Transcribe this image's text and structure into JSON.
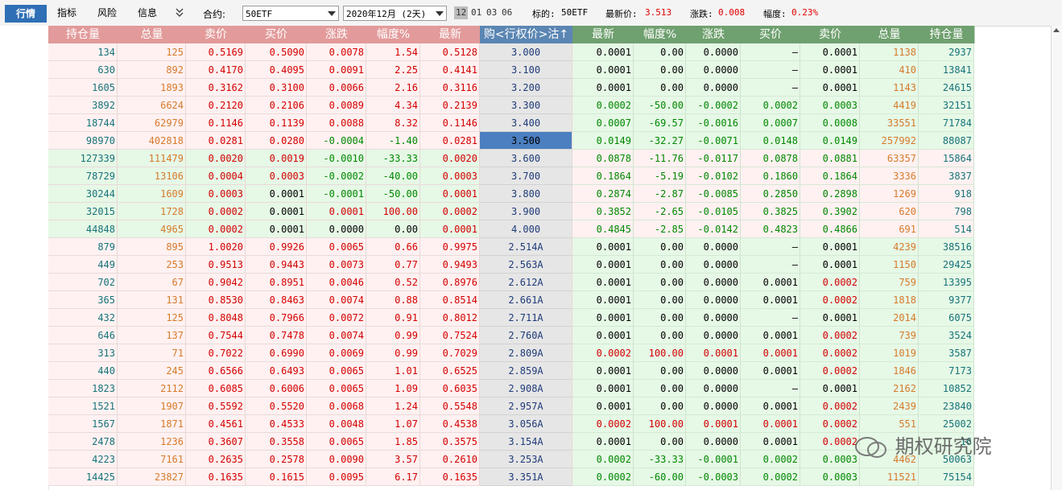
{
  "tabs": [
    {
      "label": "行情"
    },
    {
      "label": "指标"
    },
    {
      "label": "风险"
    },
    {
      "label": "信息"
    }
  ],
  "contract_label": "合约:",
  "contract_value": "50ETF",
  "month_value": "2020年12月 (2天)",
  "months": [
    "12",
    "01",
    "03",
    "06"
  ],
  "underlying_label": "标的:",
  "underlying_value": "50ETF",
  "last_label": "最新价:",
  "last_value": "3.513",
  "change_label": "涨跌:",
  "change_value": "0.008",
  "pct_label": "幅度:",
  "pct_value": "0.23%",
  "headers_left": [
    "持仓量",
    "总量",
    "卖价",
    "买价",
    "涨跌",
    "幅度%",
    "最新"
  ],
  "header_center": "购<行权价>沽↑",
  "headers_right": [
    "最新",
    "幅度%",
    "涨跌",
    "买价",
    "卖价",
    "总量",
    "持仓量"
  ],
  "rows": [
    [
      "134",
      "125",
      "0.5169",
      "0.5090",
      "0.0078",
      "1.54",
      "0.5128",
      "3.000",
      "0.0001",
      "0.00",
      "0.0000",
      "–",
      "0.0001",
      "1138",
      "2937"
    ],
    [
      "630",
      "892",
      "0.4170",
      "0.4095",
      "0.0091",
      "2.25",
      "0.4141",
      "3.100",
      "0.0001",
      "0.00",
      "0.0000",
      "–",
      "0.0001",
      "410",
      "13841"
    ],
    [
      "1605",
      "1893",
      "0.3162",
      "0.3100",
      "0.0066",
      "2.16",
      "0.3116",
      "3.200",
      "0.0001",
      "0.00",
      "0.0000",
      "–",
      "0.0001",
      "1143",
      "24615"
    ],
    [
      "3892",
      "6624",
      "0.2120",
      "0.2106",
      "0.0089",
      "4.34",
      "0.2139",
      "3.300",
      "0.0002",
      "-50.00",
      "-0.0002",
      "0.0002",
      "0.0003",
      "4419",
      "32151"
    ],
    [
      "18744",
      "62979",
      "0.1146",
      "0.1139",
      "0.0088",
      "8.32",
      "0.1146",
      "3.400",
      "0.0007",
      "-69.57",
      "-0.0016",
      "0.0007",
      "0.0008",
      "33551",
      "71784"
    ],
    [
      "98970",
      "402818",
      "0.0281",
      "0.0280",
      "-0.0004",
      "-1.40",
      "0.0281",
      "3.500",
      "0.0149",
      "-32.27",
      "-0.0071",
      "0.0148",
      "0.0149",
      "257992",
      "88087"
    ],
    [
      "127339",
      "111479",
      "0.0020",
      "0.0019",
      "-0.0010",
      "-33.33",
      "0.0020",
      "3.600",
      "0.0878",
      "-11.76",
      "-0.0117",
      "0.0878",
      "0.0881",
      "63357",
      "15864"
    ],
    [
      "78729",
      "13106",
      "0.0004",
      "0.0003",
      "-0.0002",
      "-40.00",
      "0.0003",
      "3.700",
      "0.1864",
      "-5.19",
      "-0.0102",
      "0.1860",
      "0.1864",
      "3336",
      "3837"
    ],
    [
      "30244",
      "1609",
      "0.0003",
      "0.0001",
      "-0.0001",
      "-50.00",
      "0.0001",
      "3.800",
      "0.2874",
      "-2.87",
      "-0.0085",
      "0.2850",
      "0.2898",
      "1269",
      "918"
    ],
    [
      "32015",
      "1728",
      "0.0002",
      "0.0001",
      "0.0001",
      "100.00",
      "0.0002",
      "3.900",
      "0.3852",
      "-2.65",
      "-0.0105",
      "0.3825",
      "0.3902",
      "620",
      "798"
    ],
    [
      "44848",
      "4965",
      "0.0002",
      "0.0001",
      "0.0000",
      "0.00",
      "0.0001",
      "4.000",
      "0.4845",
      "-2.85",
      "-0.0142",
      "0.4823",
      "0.4866",
      "691",
      "514"
    ],
    [
      "879",
      "895",
      "1.0020",
      "0.9926",
      "0.0065",
      "0.66",
      "0.9975",
      "2.514A",
      "0.0001",
      "0.00",
      "0.0000",
      "–",
      "0.0001",
      "4239",
      "38516"
    ],
    [
      "449",
      "253",
      "0.9513",
      "0.9443",
      "0.0073",
      "0.77",
      "0.9493",
      "2.563A",
      "0.0001",
      "0.00",
      "0.0000",
      "–",
      "0.0001",
      "1150",
      "29425"
    ],
    [
      "702",
      "67",
      "0.9042",
      "0.8951",
      "0.0046",
      "0.52",
      "0.8976",
      "2.612A",
      "0.0001",
      "0.00",
      "0.0000",
      "0.0001",
      "0.0002",
      "759",
      "13395"
    ],
    [
      "365",
      "131",
      "0.8530",
      "0.8463",
      "0.0074",
      "0.88",
      "0.8514",
      "2.661A",
      "0.0001",
      "0.00",
      "0.0000",
      "0.0001",
      "0.0002",
      "1818",
      "9377"
    ],
    [
      "432",
      "125",
      "0.8048",
      "0.7966",
      "0.0072",
      "0.91",
      "0.8012",
      "2.711A",
      "0.0001",
      "0.00",
      "0.0000",
      "–",
      "0.0001",
      "2014",
      "6075"
    ],
    [
      "646",
      "137",
      "0.7544",
      "0.7478",
      "0.0074",
      "0.99",
      "0.7524",
      "2.760A",
      "0.0001",
      "0.00",
      "0.0000",
      "0.0001",
      "0.0002",
      "739",
      "3524"
    ],
    [
      "313",
      "71",
      "0.7022",
      "0.6990",
      "0.0069",
      "0.99",
      "0.7029",
      "2.809A",
      "0.0002",
      "100.00",
      "0.0001",
      "0.0001",
      "0.0002",
      "1019",
      "3587"
    ],
    [
      "440",
      "245",
      "0.6566",
      "0.6493",
      "0.0065",
      "1.01",
      "0.6525",
      "2.859A",
      "0.0001",
      "0.00",
      "0.0000",
      "0.0001",
      "0.0002",
      "1846",
      "7173"
    ],
    [
      "1823",
      "2112",
      "0.6085",
      "0.6006",
      "0.0065",
      "1.09",
      "0.6035",
      "2.908A",
      "0.0001",
      "0.00",
      "0.0000",
      "–",
      "0.0001",
      "2162",
      "10852"
    ],
    [
      "1521",
      "1907",
      "0.5592",
      "0.5520",
      "0.0068",
      "1.24",
      "0.5548",
      "2.957A",
      "0.0001",
      "0.00",
      "0.0000",
      "0.0001",
      "0.0002",
      "2439",
      "23840"
    ],
    [
      "1567",
      "1871",
      "0.4561",
      "0.4533",
      "0.0048",
      "1.07",
      "0.4538",
      "3.056A",
      "0.0002",
      "100.00",
      "0.0001",
      "0.0001",
      "0.0002",
      "551",
      "25002"
    ],
    [
      "2478",
      "1236",
      "0.3607",
      "0.3558",
      "0.0065",
      "1.85",
      "0.3575",
      "3.154A",
      "0.0001",
      "0.00",
      "0.0000",
      "0.0001",
      "0.0002",
      "",
      "16"
    ],
    [
      "4223",
      "7161",
      "0.2635",
      "0.2578",
      "0.0090",
      "3.57",
      "0.2610",
      "3.253A",
      "0.0002",
      "-33.33",
      "-0.0001",
      "0.0002",
      "0.0003",
      "4462",
      "50063"
    ],
    [
      "14425",
      "23827",
      "0.1635",
      "0.1615",
      "0.0095",
      "6.17",
      "0.1635",
      "3.351A",
      "0.0002",
      "-60.00",
      "-0.0003",
      "0.0002",
      "0.0003",
      "11521",
      "75154"
    ]
  ],
  "left_bg_row_types": [
    "pink",
    "pink",
    "pink",
    "pink",
    "pink",
    "pink",
    "green",
    "green",
    "green",
    "green",
    "green",
    "pink",
    "pink",
    "pink",
    "pink",
    "pink",
    "pink",
    "pink",
    "pink",
    "pink",
    "pink",
    "pink",
    "pink",
    "pink",
    "pink"
  ],
  "right_bg_row_types": [
    "green",
    "green",
    "green",
    "green",
    "green",
    "green",
    "pink",
    "pink",
    "pink",
    "pink",
    "pink",
    "green",
    "green",
    "green",
    "green",
    "green",
    "green",
    "green",
    "green",
    "green",
    "green",
    "green",
    "green",
    "green",
    "green"
  ],
  "highlight_row": 5,
  "watermark": "期权研究院"
}
